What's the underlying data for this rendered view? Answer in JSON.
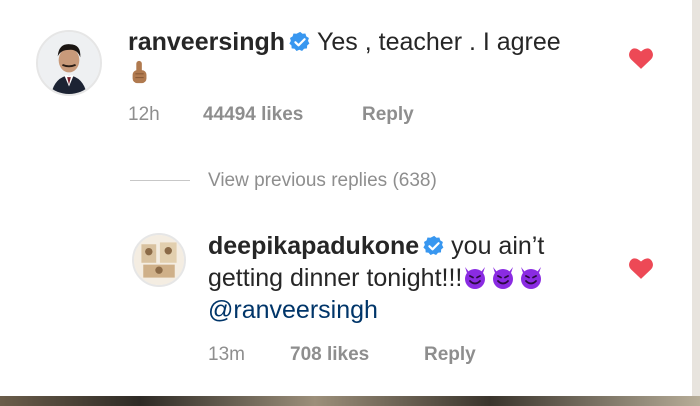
{
  "comments": [
    {
      "username": "ranveersingh",
      "text": "Yes , teacher . I agree",
      "emoji": "pointing-up-emoji",
      "time": "12h",
      "likes": "44494 likes",
      "reply": "Reply",
      "liked": true
    },
    {
      "username": "deepikapadukone",
      "text_line1": "you ain’t",
      "text_line2": "getting dinner tonight!!!",
      "emoji": "smiling-devil-emoji",
      "mention": "@ranveersingh",
      "time": "13m",
      "likes": "708 likes",
      "reply": "Reply",
      "liked": true
    }
  ],
  "view_previous_replies": "View previous replies (638)",
  "colors": {
    "heart": "#ed4956",
    "verified": "#3897f0",
    "meta": "#8e8e8e",
    "mention": "#003569",
    "devil": "#8a2be2"
  }
}
